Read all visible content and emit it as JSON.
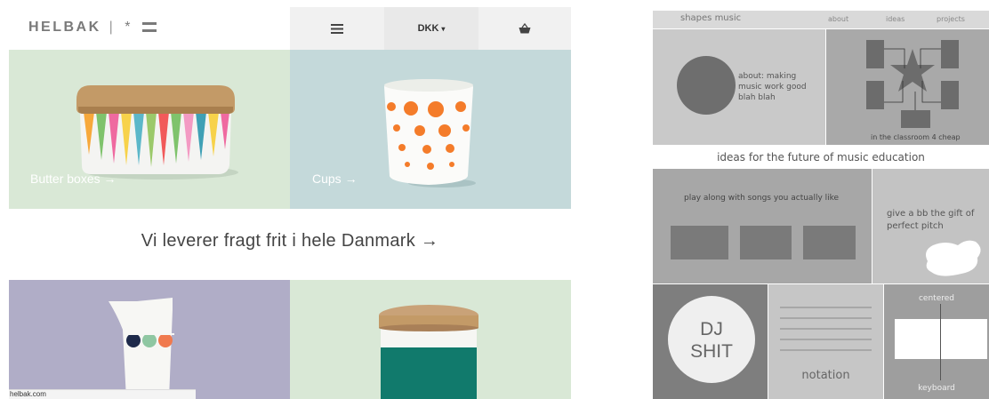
{
  "helbak": {
    "logo": {
      "wordmark": "HELBAK",
      "separator": "|",
      "star": "*"
    },
    "header": {
      "menu_icon": "hamburger-icon",
      "currency": "DKK",
      "currency_caret": "▾",
      "cart_icon": "basket-icon"
    },
    "tiles": [
      {
        "label": "Butter boxes →",
        "bg": "#d9e8d6"
      },
      {
        "label": "Cups →",
        "bg": "#c4d9da"
      },
      {
        "label": "",
        "bg": "#b0adc7"
      },
      {
        "label": "",
        "bg": "#d9e8d6"
      }
    ],
    "banner": "Vi leverer fragt frit i hele Danmark →",
    "status_url": "helbak.com"
  },
  "shapes_music": {
    "brand": "shapes music",
    "nav": {
      "about": "about",
      "ideas": "ideas",
      "projects": "projects"
    },
    "about_text": "about: making music work good blah blah",
    "classroom_caption": "in the classroom 4 cheap",
    "ideas_heading": "ideas for the future of music education",
    "play_along": "play along with songs you actually like",
    "perfect_pitch": "give a bb the gift of perfect pitch",
    "dj_line1": "DJ",
    "dj_line2": "SHIT",
    "notation": "notation",
    "centered": "centered",
    "keyboard": "keyboard"
  }
}
